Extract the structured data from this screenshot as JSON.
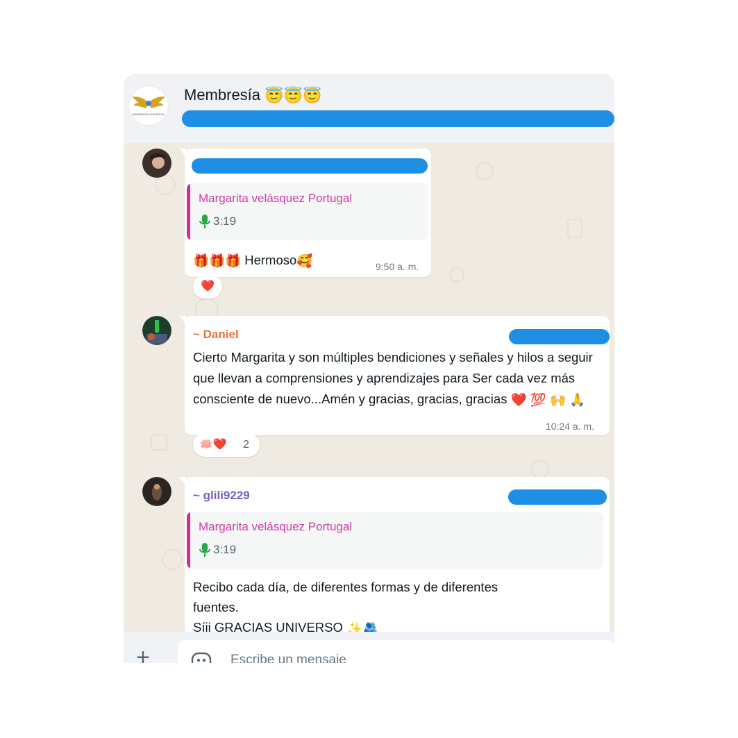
{
  "header": {
    "title": "Membresía",
    "title_emojis": "😇😇😇",
    "avatar_logo_text": "MEMBRESÍA UNIVERSAL"
  },
  "messages": [
    {
      "quote": {
        "name": "Margarita velásquez Portugal",
        "duration": "3:19"
      },
      "text": "Hermoso",
      "text_emojis_before": "🎁🎁🎁",
      "text_emoji_after": "🥰",
      "time": "9:50 a. m.",
      "reaction": {
        "emoji": "❤️"
      }
    },
    {
      "sender": "~ Daniel",
      "text": "Cierto Margarita y son múltiples bendiciones y señales y hilos a seguir que llevan a comprensiones y aprendizajes para Ser cada vez más consciente de nuevo...Amén y gracias, gracias, gracias",
      "text_emojis": "❤️ 💯 🙌 🙏",
      "time": "10:24 a. m.",
      "reaction": {
        "emoji": "🪷❤️",
        "count": "2"
      }
    },
    {
      "sender": "~ glili9229",
      "quote": {
        "name": "Margarita velásquez Portugal",
        "duration": "3:19"
      },
      "text_line1": "Recibo cada día, de diferentes formas y de diferentes",
      "text_line2": "fuentes.",
      "text_line3": "Síii GRACIAS UNIVERSO",
      "text_line3_emojis": "✨🫂"
    }
  ],
  "composer": {
    "placeholder": "Escribe un mensaje",
    "plus_icon": "+"
  },
  "colors": {
    "accent_pink": "#cf3da6",
    "sender_orange": "#e8743b",
    "sender_purple": "#7a5cc9",
    "redaction_blue": "#1f8fe6",
    "chat_bg": "#efeae2"
  }
}
